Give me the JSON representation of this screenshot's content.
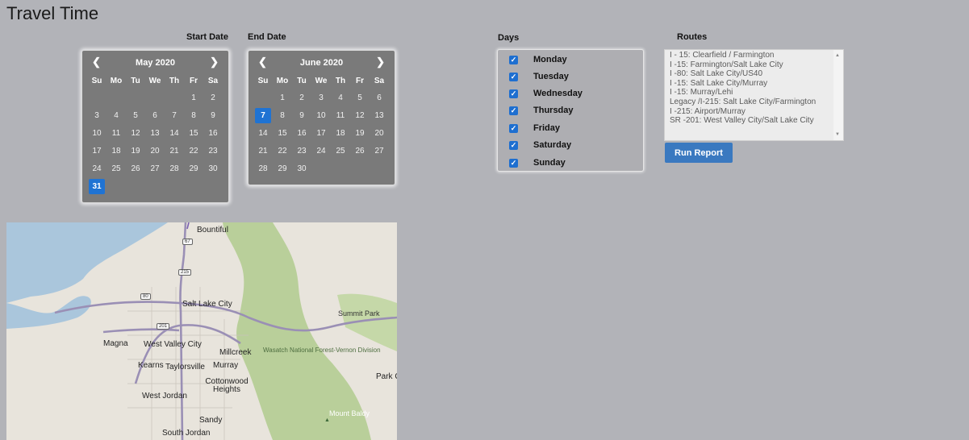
{
  "page": {
    "title": "Travel Time"
  },
  "labels": {
    "start_date": "Start Date",
    "end_date": "End Date",
    "days": "Days",
    "routes": "Routes"
  },
  "weekdays": [
    "Su",
    "Mo",
    "Tu",
    "We",
    "Th",
    "Fr",
    "Sa"
  ],
  "start_calendar": {
    "month": "May 2020",
    "selected_day": "31",
    "weeks": [
      [
        "",
        "",
        "",
        "",
        "",
        "1",
        "2"
      ],
      [
        "3",
        "4",
        "5",
        "6",
        "7",
        "8",
        "9"
      ],
      [
        "10",
        "11",
        "12",
        "13",
        "14",
        "15",
        "16"
      ],
      [
        "17",
        "18",
        "19",
        "20",
        "21",
        "22",
        "23"
      ],
      [
        "24",
        "25",
        "26",
        "27",
        "28",
        "29",
        "30"
      ],
      [
        "31",
        "",
        "",
        "",
        "",
        "",
        ""
      ]
    ]
  },
  "end_calendar": {
    "month": "June 2020",
    "selected_day": "7",
    "weeks": [
      [
        "",
        "1",
        "2",
        "3",
        "4",
        "5",
        "6"
      ],
      [
        "7",
        "8",
        "9",
        "10",
        "11",
        "12",
        "13"
      ],
      [
        "14",
        "15",
        "16",
        "17",
        "18",
        "19",
        "20"
      ],
      [
        "21",
        "22",
        "23",
        "24",
        "25",
        "26",
        "27"
      ],
      [
        "28",
        "29",
        "30",
        "",
        "",
        "",
        ""
      ]
    ]
  },
  "days": [
    {
      "name": "Monday",
      "checked": true
    },
    {
      "name": "Tuesday",
      "checked": true
    },
    {
      "name": "Wednesday",
      "checked": true
    },
    {
      "name": "Thursday",
      "checked": true
    },
    {
      "name": "Friday",
      "checked": true
    },
    {
      "name": "Saturday",
      "checked": true
    },
    {
      "name": "Sunday",
      "checked": true
    }
  ],
  "routes": [
    "I - 15: Clearfield / Farmington",
    "I -15: Farmington/Salt Lake City",
    "I -80: Salt Lake City/US40",
    "I -15: Salt Lake City/Murray",
    "I -15: Murray/Lehi",
    "Legacy /I-215: Salt Lake City/Farmington",
    "I -215: Airport/Murray",
    "SR -201: West Valley City/Salt Lake City"
  ],
  "run_button": "Run Report",
  "map": {
    "places": {
      "bountiful": "Bountiful",
      "salt_lake_city": "Salt Lake City",
      "summit_park": "Summit Park",
      "magna": "Magna",
      "west_valley_city": "West Valley City",
      "millcreek": "Millcreek",
      "wasatch": "Wasatch National Forest-Vernon Division",
      "kearns": "Kearns",
      "taylorsville": "Taylorsville",
      "murray": "Murray",
      "cottonwood_heights": "Cottonwood Heights",
      "park_city": "Park C",
      "west_jordan": "West Jordan",
      "sandy": "Sandy",
      "south_jordan": "South Jordan",
      "mount_baldy": "Mount Baldy"
    },
    "shields": {
      "i67": "67",
      "i215": "215",
      "i80": "80",
      "sr201": "201"
    },
    "colors": {
      "water": "#aac6dc",
      "forest": "#b9cf9a",
      "land": "#e8e4dc",
      "highway": "#9a8fb5"
    }
  },
  "icons": {
    "prev": "chevron-left-icon",
    "next": "chevron-right-icon",
    "check": "checkmark-icon"
  }
}
